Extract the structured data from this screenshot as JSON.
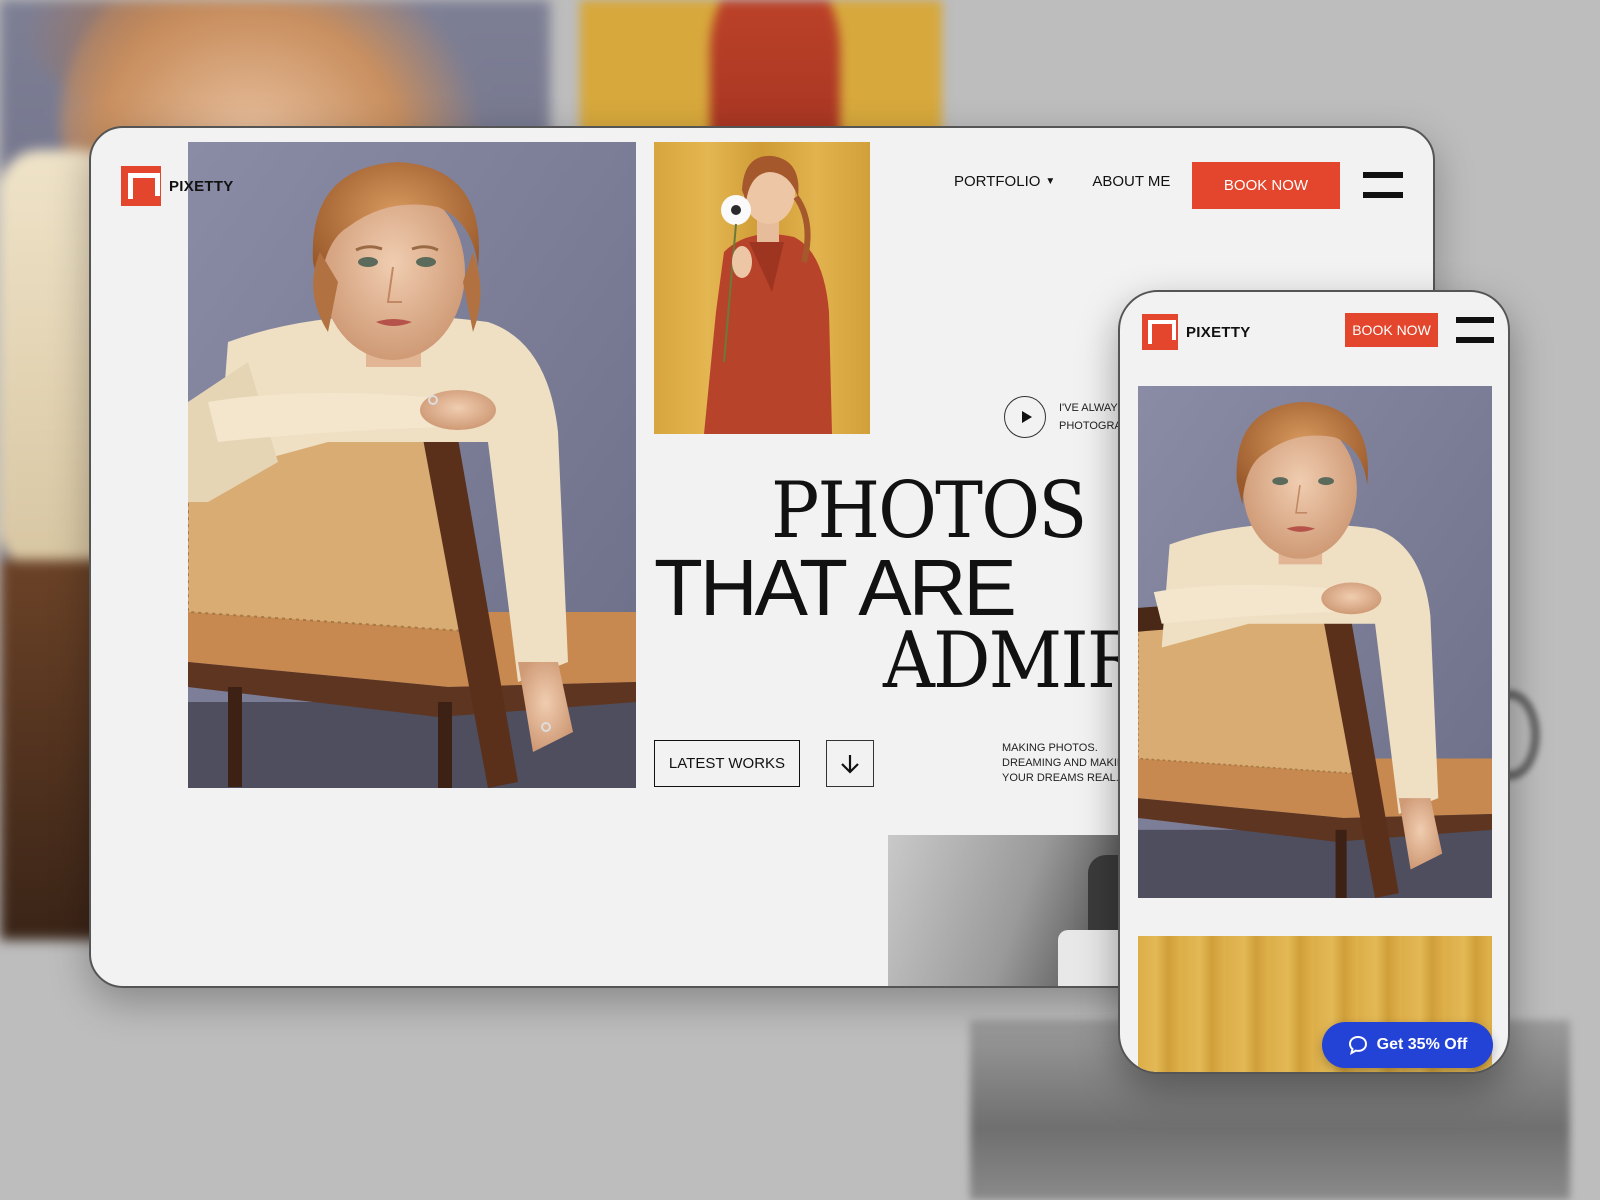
{
  "brand": {
    "name": "PIXETTY",
    "accent": "#e3462c",
    "promo_color": "#2343d6"
  },
  "desktop": {
    "nav": {
      "portfolio": "PORTFOLIO",
      "about": "ABOUT ME",
      "book_now": "BOOK NOW"
    },
    "quote_line1": "I'VE ALWAYS",
    "quote_line2": "PHOTOGRA",
    "headline": {
      "line1": "PHOTOS",
      "line2": "THAT ARE",
      "line3": "ADMIR"
    },
    "latest_works": "LATEST WORKS",
    "tagline": {
      "line1": "MAKING PHOTOS.",
      "line2": "DREAMING AND MAKIN",
      "line3": "YOUR DREAMS REAL."
    }
  },
  "mobile": {
    "book_now": "BOOK NOW",
    "promo": "Get 35% Off"
  },
  "icons": [
    "logo-icon",
    "caret-down-icon",
    "hamburger-menu-icon",
    "play-icon",
    "arrow-down-icon",
    "chat-bubble-icon"
  ]
}
